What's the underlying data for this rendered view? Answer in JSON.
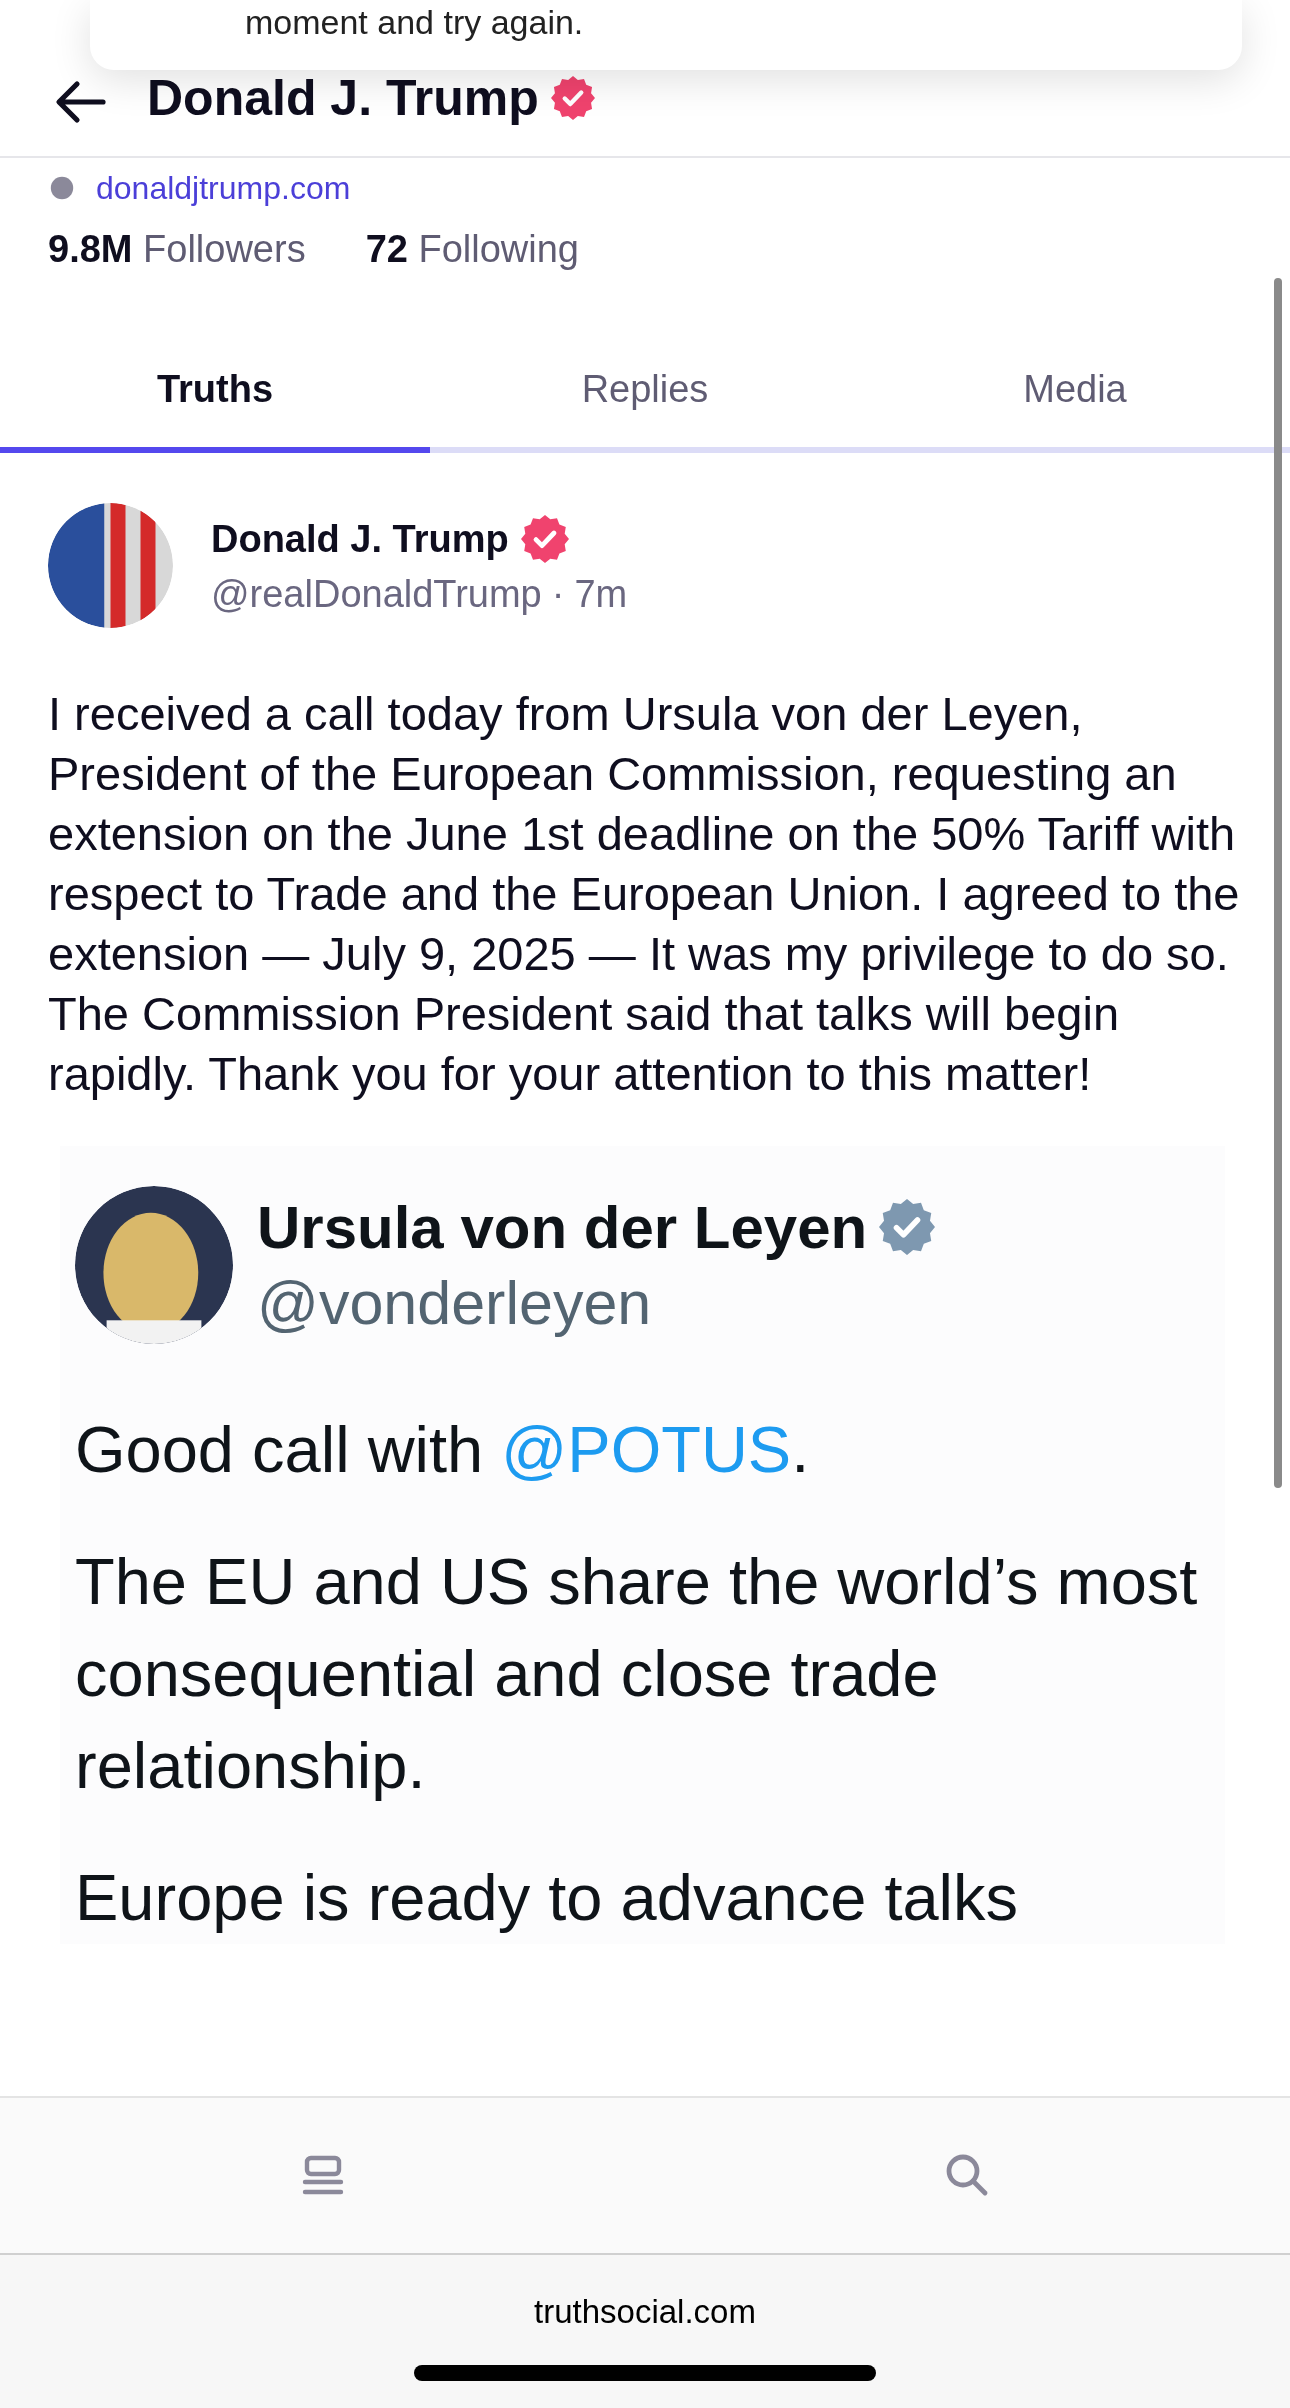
{
  "toast": {
    "message": "moment and try again."
  },
  "header": {
    "title": "Donald J. Trump",
    "verified": true
  },
  "profile": {
    "website": "donaldjtrump.com",
    "stats": [
      "**9.8M** Followers",
      "**72** Following"
    ]
  },
  "tabs": [
    {
      "label": "Truths",
      "selected": true
    },
    {
      "label": "Replies",
      "selected": false
    },
    {
      "label": "Media",
      "selected": false
    }
  ],
  "post": {
    "author": "Donald J. Trump",
    "verified": true,
    "handle": "@realDonaldTrump",
    "separator": "·",
    "time": "7m",
    "text": "I received a call today from Ursula von der Leyen, President of the European Commission, requesting an extension on the June 1st deadline on the 50% Tariff with respect to Trade and the European Union. I agreed to the extension — July 9, 2025 — It was my privilege to do so. The Commission President said that talks will begin rapidly. Thank you for your attention to this matter!",
    "attachment": {
      "kind": "screenshot",
      "author": "Ursula von der Leyen",
      "verified": true,
      "handle": "@vonderleyen",
      "paragraphs": [
        [
          {
            "text": "Good call with "
          },
          {
            "text": "@POTUS",
            "kind": "mention"
          },
          {
            "text": "."
          }
        ],
        [
          {
            "text": "The EU and US share the world’s most consequential and close trade relationship."
          }
        ],
        [
          {
            "text": "Europe is ready to advance talks"
          }
        ]
      ]
    }
  },
  "bottom_nav": [
    {
      "kind": "feed"
    },
    {
      "kind": "search"
    }
  ],
  "browser": {
    "url": "truthsocial.com"
  }
}
